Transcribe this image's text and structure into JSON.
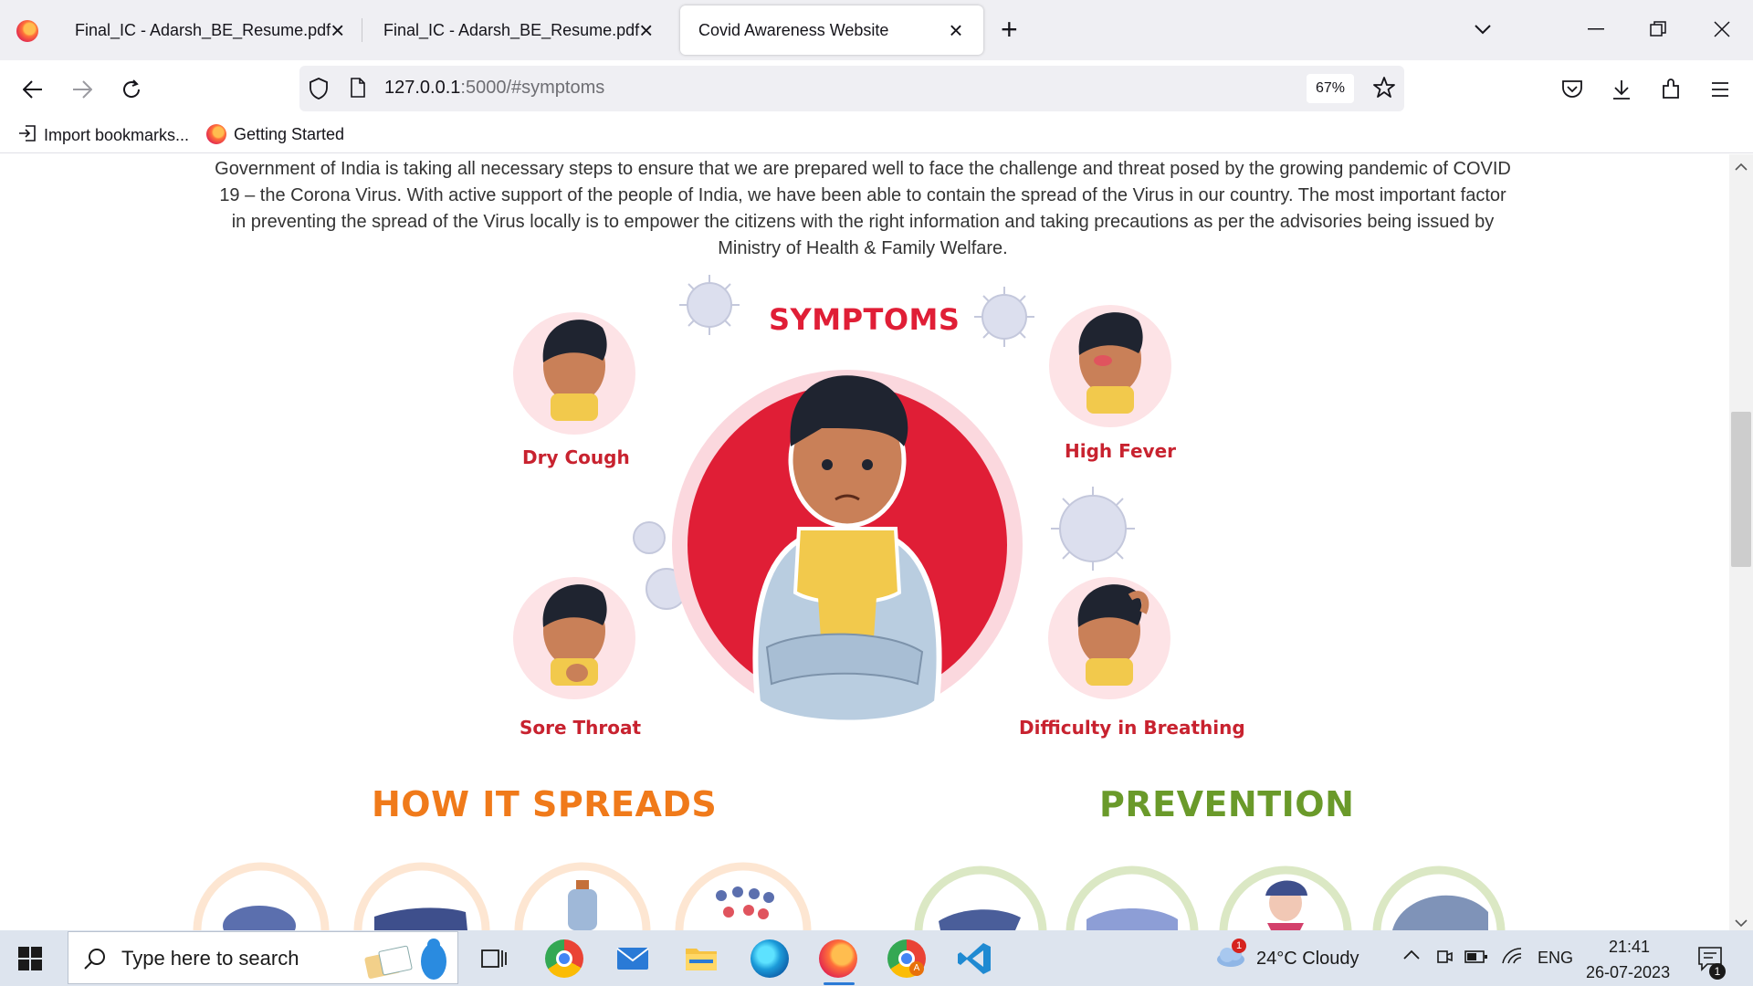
{
  "browser": {
    "tabs": [
      {
        "label": "Final_IC - Adarsh_BE_Resume.pdf",
        "active": false
      },
      {
        "label": "Final_IC - Adarsh_BE_Resume.pdf",
        "active": false
      },
      {
        "label": "Covid Awareness Website",
        "active": true
      }
    ],
    "url_host": "127.0.0.1",
    "url_path": ":5000/#symptoms",
    "zoom": "67%",
    "bookmarks": [
      "Import bookmarks...",
      "Getting Started"
    ]
  },
  "page": {
    "intro": "Government of India is taking all necessary steps to ensure that we are prepared well to face the challenge and threat posed by the growing pandemic of COVID 19 – the Corona Virus. With active support of the people of India, we have been able to contain the spread of the Virus in our country. The most important factor in preventing the spread of the Virus locally is to empower the citizens with the right information and taking precautions as per the advisories being issued by Ministry of Health & Family Welfare.",
    "symptoms_title": "SYMPTOMS",
    "symptoms": [
      "Dry Cough",
      "High Fever",
      "Sore Throat",
      "Difficulty in Breathing"
    ],
    "spreads_title": "HOW IT SPREADS",
    "prevention_title": "PREVENTION",
    "colors": {
      "symptoms": "#e01e36",
      "spreads": "#f07a1a",
      "prevention": "#6a9a2a"
    }
  },
  "taskbar": {
    "search_placeholder": "Type here to search",
    "weather": "24°C  Cloudy",
    "weather_badge": "1",
    "language": "ENG",
    "time": "21:41",
    "date": "26-07-2023",
    "notif_count": "1"
  }
}
